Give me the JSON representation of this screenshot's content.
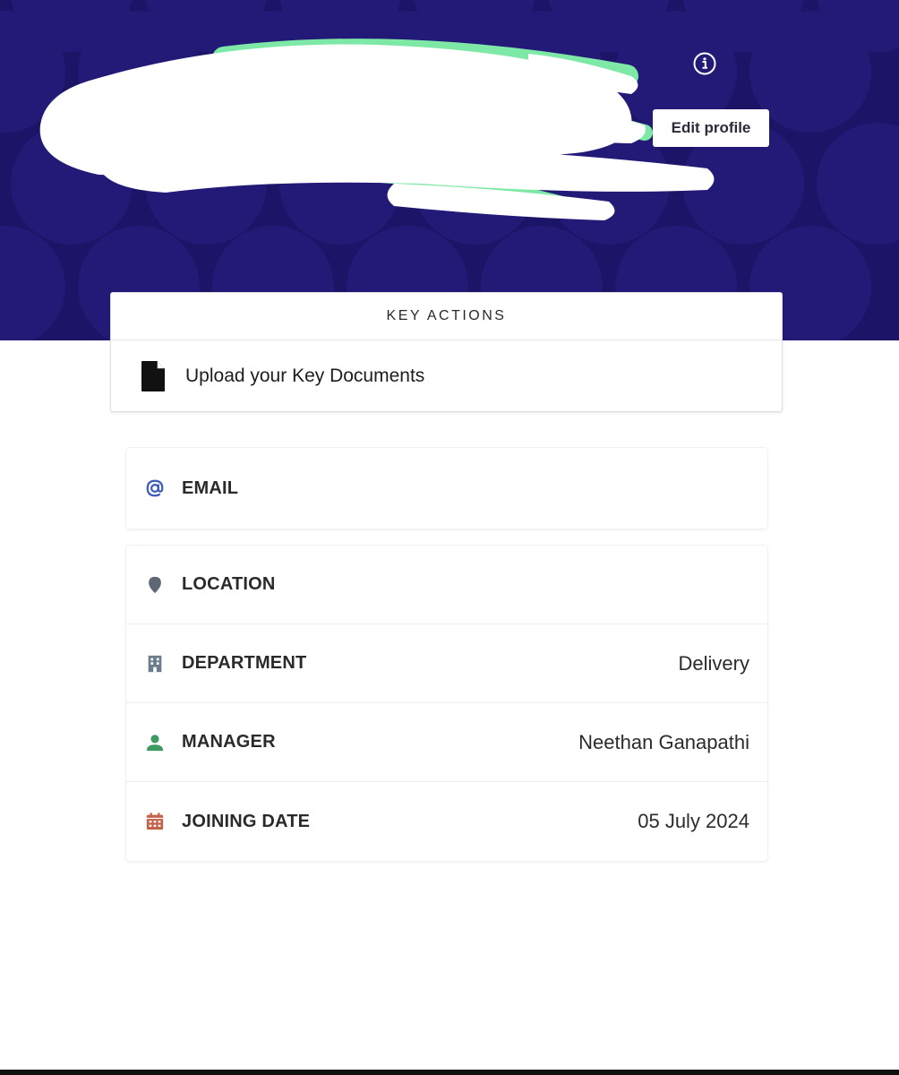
{
  "header": {
    "edit_profile_label": "Edit profile",
    "info_icon": "info-icon",
    "background_color": "#1c1466",
    "pattern_color": "#231a78"
  },
  "key_actions": {
    "title": "KEY ACTIONS",
    "items": [
      {
        "icon": "document-icon",
        "label": "Upload your Key Documents"
      }
    ]
  },
  "contact": {
    "email": {
      "icon": "at-sign-icon",
      "label": "EMAIL",
      "value": ""
    }
  },
  "details": {
    "location": {
      "icon": "location-pin-icon",
      "label": "LOCATION",
      "value": ""
    },
    "department": {
      "icon": "building-icon",
      "label": "DEPARTMENT",
      "value": "Delivery"
    },
    "manager": {
      "icon": "person-icon",
      "label": "MANAGER",
      "value": "Neethan Ganapathi"
    },
    "joining": {
      "icon": "calendar-icon",
      "label": "JOINING DATE",
      "value": "05 July 2024"
    }
  },
  "colors": {
    "at_icon": "#3b5cb8",
    "location_icon": "#5f6775",
    "building_icon": "#6b7d8c",
    "person_icon": "#3f9a63",
    "calendar_icon": "#c2644b"
  }
}
